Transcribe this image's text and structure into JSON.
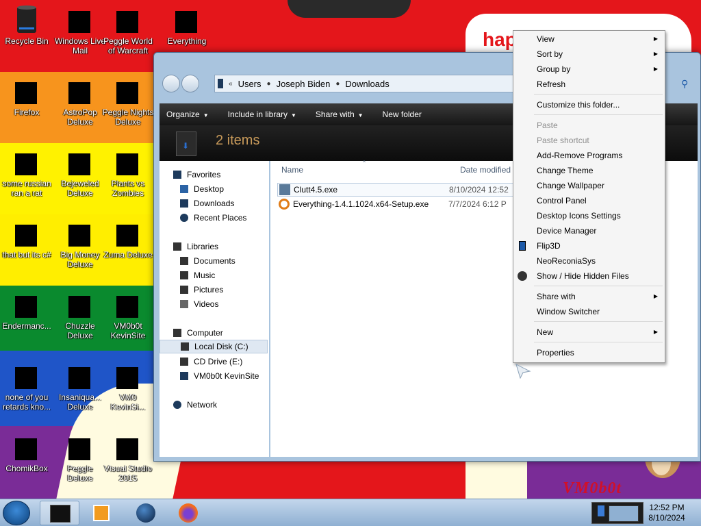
{
  "desktop": {
    "icons": [
      {
        "label": "Recycle Bin",
        "icon": "recycle-bin-icon"
      },
      {
        "label": "Windows Live Mail",
        "icon": "mail-icon"
      },
      {
        "label": "Peggle World of Warcraft",
        "icon": "game-icon"
      },
      {
        "label": "Everything",
        "icon": "search-icon"
      },
      {
        "label": "Firefox",
        "icon": "firefox-icon"
      },
      {
        "label": "AstroPop Deluxe",
        "icon": "game-icon"
      },
      {
        "label": "Peggle Nights Deluxe",
        "icon": "game-icon"
      },
      {
        "label": "some russian ran a rat",
        "icon": "app-icon"
      },
      {
        "label": "Bejeweled Deluxe",
        "icon": "game-icon"
      },
      {
        "label": "Plants vs Zombies",
        "icon": "game-icon"
      },
      {
        "label": "that but its c#",
        "icon": "app-icon"
      },
      {
        "label": "Big Money Deluxe",
        "icon": "game-icon"
      },
      {
        "label": "Zuma Deluxe",
        "icon": "game-icon"
      },
      {
        "label": "Endermanc...",
        "icon": "app-icon"
      },
      {
        "label": "Chuzzle Deluxe",
        "icon": "game-icon"
      },
      {
        "label": "VM0b0t KevinSite",
        "icon": "app-icon"
      },
      {
        "label": "none of you retards kno...",
        "icon": "app-icon"
      },
      {
        "label": "Insaniqua... Deluxe",
        "icon": "game-icon"
      },
      {
        "label": "VM0 KevinSi...",
        "icon": "app-icon"
      },
      {
        "label": "ChomikBox",
        "icon": "app-icon"
      },
      {
        "label": "Peggle Deluxe",
        "icon": "game-icon"
      },
      {
        "label": "Visual Studio 2015",
        "icon": "visual-studio-icon"
      }
    ],
    "wallpaper_text": "hap",
    "wallpaper_signature": "VM0b0t"
  },
  "explorer": {
    "breadcrumb": [
      "Users",
      "Joseph Biden",
      "Downloads"
    ],
    "breadcrumb_prefix": "«",
    "toolbar": {
      "organize": "Organize",
      "include_in_library": "Include in library",
      "share_with": "Share with",
      "new_folder": "New folder"
    },
    "details": {
      "item_count": "2 items"
    },
    "columns": {
      "name": "Name",
      "date_modified": "Date modified"
    },
    "files": [
      {
        "name": "Clutt4.5.exe",
        "date": "8/10/2024 12:52"
      },
      {
        "name": "Everything-1.4.1.1024.x64-Setup.exe",
        "date": "7/7/2024 6:12 P"
      }
    ],
    "nav": {
      "favorites": "Favorites",
      "favorites_items": [
        "Desktop",
        "Downloads",
        "Recent Places"
      ],
      "libraries": "Libraries",
      "libraries_items": [
        "Documents",
        "Music",
        "Pictures",
        "Videos"
      ],
      "computer": "Computer",
      "computer_items": [
        "Local Disk (C:)",
        "CD Drive (E:)",
        "VM0b0t KevinSite"
      ],
      "network": "Network"
    }
  },
  "context_menu": {
    "view": "View",
    "sort_by": "Sort by",
    "group_by": "Group by",
    "refresh": "Refresh",
    "customize": "Customize this folder...",
    "paste": "Paste",
    "paste_shortcut": "Paste shortcut",
    "add_remove_programs": "Add-Remove Programs",
    "change_theme": "Change Theme",
    "change_wallpaper": "Change Wallpaper",
    "control_panel": "Control Panel",
    "desktop_icons_settings": "Desktop Icons Settings",
    "device_manager": "Device Manager",
    "flip3d": "Flip3D",
    "neoreconiasys": "NeoReconiaSys",
    "show_hide_hidden": "Show / Hide Hidden Files",
    "share_with": "Share with",
    "window_switcher": "Window Switcher",
    "new": "New",
    "properties": "Properties"
  },
  "taskbar": {
    "time": "12:52 PM",
    "date": "8/10/2024"
  },
  "colors": {
    "wallpaper_red": "#e4161b",
    "explorer_toolbar": "#1c1c1c",
    "taskbar": "#a9c4e0"
  }
}
